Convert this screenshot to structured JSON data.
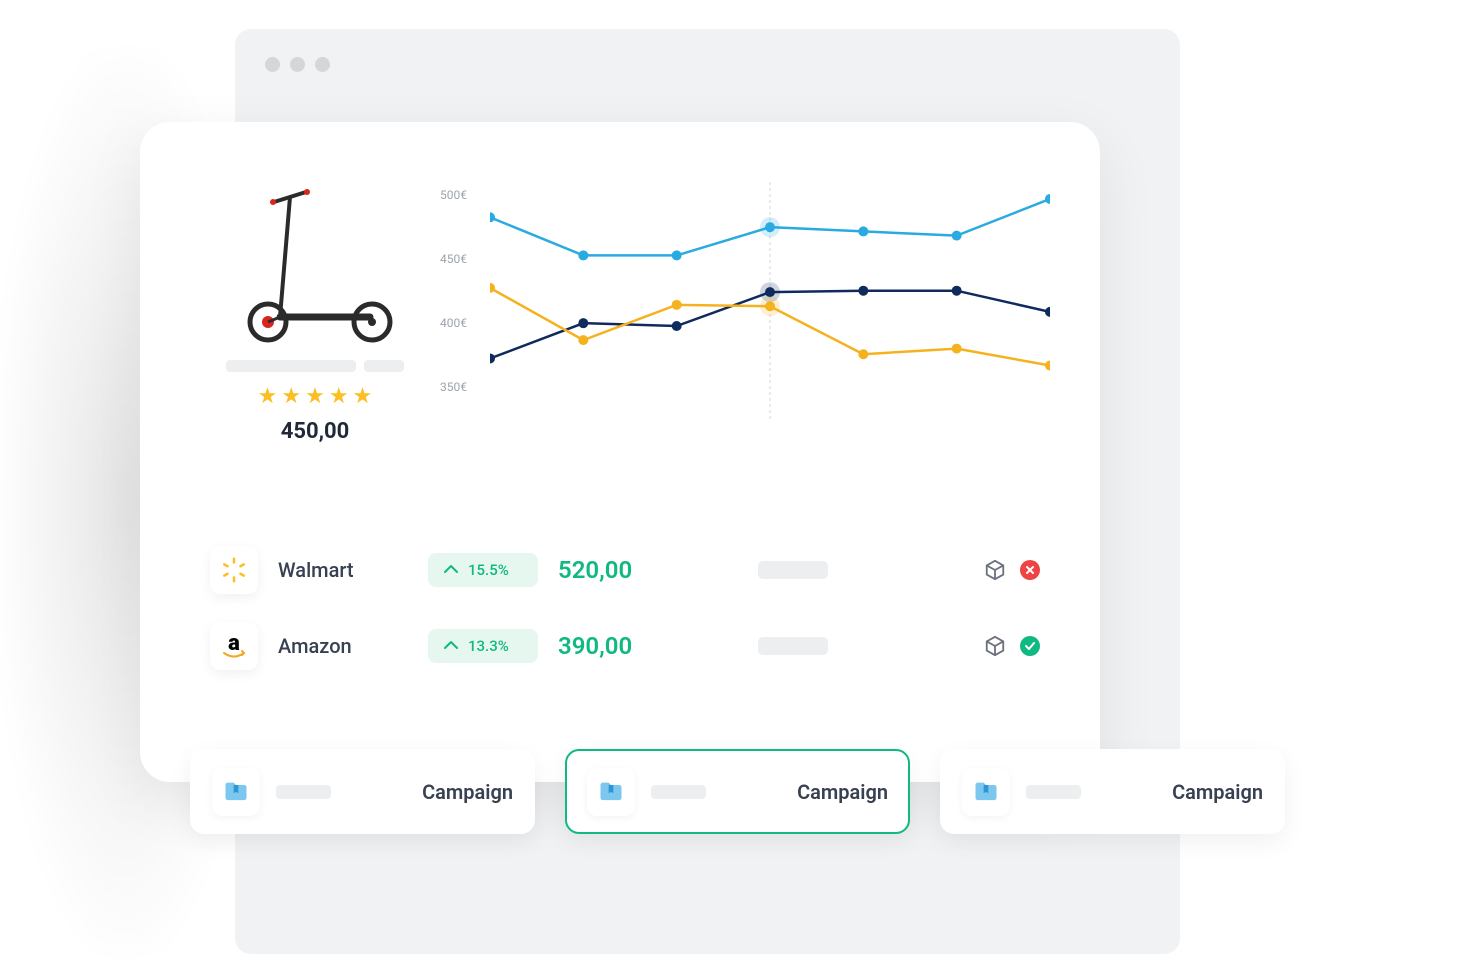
{
  "product": {
    "price": "450,00",
    "rating": 5
  },
  "chart_data": {
    "type": "line",
    "ylabel": "",
    "y_ticks": [
      "500€",
      "450€",
      "400€",
      "350€"
    ],
    "ylim": [
      340,
      510
    ],
    "x_count": 7,
    "series": [
      {
        "name": "series-blue",
        "color": "#29abe2",
        "values": [
          485,
          458,
          458,
          478,
          475,
          472,
          498
        ]
      },
      {
        "name": "series-dark",
        "color": "#0f2a5c",
        "values": [
          385,
          410,
          408,
          432,
          433,
          433,
          418
        ]
      },
      {
        "name": "series-yellow",
        "color": "#f5b21e",
        "values": [
          435,
          398,
          423,
          422,
          388,
          392,
          380
        ]
      }
    ],
    "highlight_x_index": 3
  },
  "competitors": [
    {
      "logo_name": "walmart-icon",
      "name": "Walmart",
      "change": "15.5%",
      "price": "520,00",
      "status": "error"
    },
    {
      "logo_name": "amazon-icon",
      "name": "Amazon",
      "change": "13.3%",
      "price": "390,00",
      "status": "ok"
    }
  ],
  "tabs": [
    {
      "label": "Campaign",
      "active": false
    },
    {
      "label": "Campaign",
      "active": true
    },
    {
      "label": "Campaign",
      "active": false
    }
  ],
  "colors": {
    "accent": "#10b981",
    "star": "#fbbf24"
  }
}
